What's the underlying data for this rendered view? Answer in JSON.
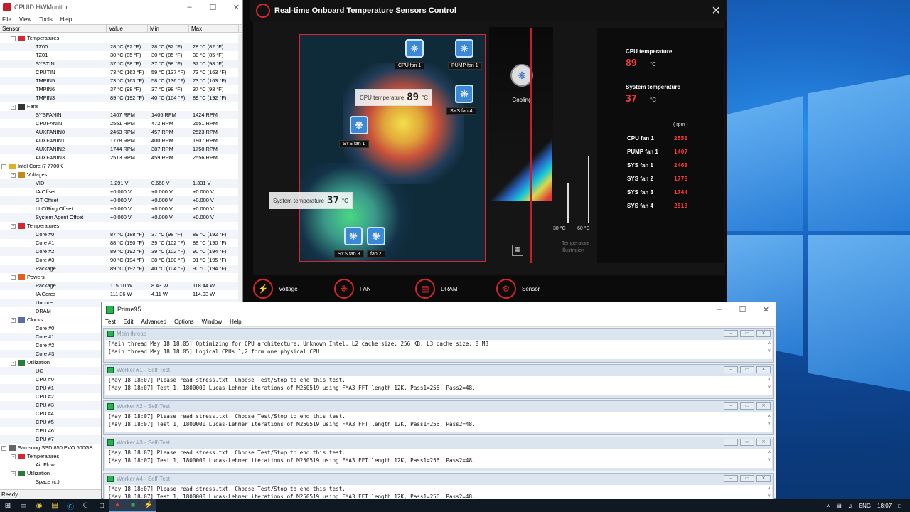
{
  "hwmonitor": {
    "title": "CPUID HWMonitor",
    "menu": [
      "File",
      "View",
      "Tools",
      "Help"
    ],
    "columns": [
      "Sensor",
      "Value",
      "Min",
      "Max"
    ],
    "status": "Ready",
    "rows": [
      {
        "indent": 2,
        "label": "Temperatures",
        "icon": "thermometer-icon",
        "toggle": "-"
      },
      {
        "indent": 3,
        "label": "TZ00",
        "v": "28 °C  (82 °F)",
        "min": "28 °C  (82 °F)",
        "max": "28 °C  (82 °F)"
      },
      {
        "indent": 3,
        "label": "TZ01",
        "v": "30 °C  (85 °F)",
        "min": "30 °C  (85 °F)",
        "max": "30 °C  (85 °F)"
      },
      {
        "indent": 3,
        "label": "SYSTIN",
        "v": "37 °C  (98 °F)",
        "min": "37 °C  (98 °F)",
        "max": "37 °C  (98 °F)"
      },
      {
        "indent": 3,
        "label": "CPUTIN",
        "v": "73 °C  (163 °F)",
        "min": "59 °C  (137 °F)",
        "max": "73 °C  (163 °F)"
      },
      {
        "indent": 3,
        "label": "TMPIN5",
        "v": "73 °C  (163 °F)",
        "min": "58 °C  (136 °F)",
        "max": "73 °C  (163 °F)"
      },
      {
        "indent": 3,
        "label": "TMPIN6",
        "v": "37 °C  (98 °F)",
        "min": "37 °C  (98 °F)",
        "max": "37 °C  (98 °F)"
      },
      {
        "indent": 3,
        "label": "TMPIN3",
        "v": "89 °C  (192 °F)",
        "min": "40 °C  (104 °F)",
        "max": "89 °C  (192 °F)"
      },
      {
        "indent": 2,
        "label": "Fans",
        "icon": "fan-icon",
        "toggle": "-"
      },
      {
        "indent": 3,
        "label": "SYSFANIN",
        "v": "1407 RPM",
        "min": "1406 RPM",
        "max": "1424 RPM"
      },
      {
        "indent": 3,
        "label": "CPUFANIN",
        "v": "2551 RPM",
        "min": "472 RPM",
        "max": "2551 RPM"
      },
      {
        "indent": 3,
        "label": "AUXFANIN0",
        "v": "2463 RPM",
        "min": "457 RPM",
        "max": "2523 RPM"
      },
      {
        "indent": 3,
        "label": "AUXFANIN1",
        "v": "1778 RPM",
        "min": "400 RPM",
        "max": "1807 RPM"
      },
      {
        "indent": 3,
        "label": "AUXFANIN2",
        "v": "1744 RPM",
        "min": "387 RPM",
        "max": "1750 RPM"
      },
      {
        "indent": 3,
        "label": "AUXFANIN3",
        "v": "2513 RPM",
        "min": "459 RPM",
        "max": "2556 RPM"
      },
      {
        "indent": 1,
        "label": "Intel Core i7 7700K",
        "icon": "chip-icon",
        "toggle": "-"
      },
      {
        "indent": 2,
        "label": "Voltages",
        "icon": "voltage-icon",
        "toggle": "-"
      },
      {
        "indent": 3,
        "label": "VID",
        "v": "1.291 V",
        "min": "0.668 V",
        "max": "1.331 V"
      },
      {
        "indent": 3,
        "label": "IA Offset",
        "v": "+0.000 V",
        "min": "+0.000 V",
        "max": "+0.000 V"
      },
      {
        "indent": 3,
        "label": "GT Offset",
        "v": "+0.000 V",
        "min": "+0.000 V",
        "max": "+0.000 V"
      },
      {
        "indent": 3,
        "label": "LLC/Ring Offset",
        "v": "+0.000 V",
        "min": "+0.000 V",
        "max": "+0.000 V"
      },
      {
        "indent": 3,
        "label": "System Agent Offset",
        "v": "+0.000 V",
        "min": "+0.000 V",
        "max": "+0.000 V"
      },
      {
        "indent": 2,
        "label": "Temperatures",
        "icon": "thermometer-icon",
        "toggle": "-"
      },
      {
        "indent": 3,
        "label": "Core #0",
        "v": "87 °C  (188 °F)",
        "min": "37 °C  (98 °F)",
        "max": "89 °C  (192 °F)"
      },
      {
        "indent": 3,
        "label": "Core #1",
        "v": "88 °C  (190 °F)",
        "min": "39 °C  (102 °F)",
        "max": "88 °C  (190 °F)"
      },
      {
        "indent": 3,
        "label": "Core #2",
        "v": "89 °C  (192 °F)",
        "min": "39 °C  (102 °F)",
        "max": "90 °C  (194 °F)"
      },
      {
        "indent": 3,
        "label": "Core #3",
        "v": "90 °C  (194 °F)",
        "min": "38 °C  (100 °F)",
        "max": "91 °C  (195 °F)"
      },
      {
        "indent": 3,
        "label": "Package",
        "v": "89 °C  (192 °F)",
        "min": "40 °C  (104 °F)",
        "max": "90 °C  (194 °F)"
      },
      {
        "indent": 2,
        "label": "Powers",
        "icon": "power-icon",
        "toggle": "-"
      },
      {
        "indent": 3,
        "label": "Package",
        "v": "115.10 W",
        "min": "8.43 W",
        "max": "118.44 W"
      },
      {
        "indent": 3,
        "label": "IA Cores",
        "v": "111.36 W",
        "min": "4.11 W",
        "max": "114.93 W"
      },
      {
        "indent": 3,
        "label": "Uncore",
        "v": "",
        "min": "",
        "max": ""
      },
      {
        "indent": 3,
        "label": "DRAM",
        "v": "",
        "min": "",
        "max": ""
      },
      {
        "indent": 2,
        "label": "Clocks",
        "icon": "clock-icon",
        "toggle": "-"
      },
      {
        "indent": 3,
        "label": "Core #0",
        "v": "",
        "min": "",
        "max": ""
      },
      {
        "indent": 3,
        "label": "Core #1",
        "v": "",
        "min": "",
        "max": ""
      },
      {
        "indent": 3,
        "label": "Core #2",
        "v": "",
        "min": "",
        "max": ""
      },
      {
        "indent": 3,
        "label": "Core #3",
        "v": "",
        "min": "",
        "max": ""
      },
      {
        "indent": 2,
        "label": "Utilization",
        "icon": "utilization-icon",
        "toggle": "-"
      },
      {
        "indent": 3,
        "label": "UC",
        "v": "",
        "min": "",
        "max": ""
      },
      {
        "indent": 3,
        "label": "CPU #0",
        "v": "",
        "min": "",
        "max": ""
      },
      {
        "indent": 3,
        "label": "CPU #1",
        "v": "",
        "min": "",
        "max": ""
      },
      {
        "indent": 3,
        "label": "CPU #2",
        "v": "",
        "min": "",
        "max": ""
      },
      {
        "indent": 3,
        "label": "CPU #3",
        "v": "",
        "min": "",
        "max": ""
      },
      {
        "indent": 3,
        "label": "CPU #4",
        "v": "",
        "min": "",
        "max": ""
      },
      {
        "indent": 3,
        "label": "CPU #5",
        "v": "",
        "min": "",
        "max": ""
      },
      {
        "indent": 3,
        "label": "CPU #6",
        "v": "",
        "min": "",
        "max": ""
      },
      {
        "indent": 3,
        "label": "CPU #7",
        "v": "",
        "min": "",
        "max": ""
      },
      {
        "indent": 1,
        "label": "Samsung SSD 850 EVO 500GB",
        "icon": "drive-icon",
        "toggle": "-"
      },
      {
        "indent": 2,
        "label": "Temperatures",
        "icon": "thermometer-icon",
        "toggle": "-"
      },
      {
        "indent": 3,
        "label": "Air Flow",
        "v": "",
        "min": "",
        "max": ""
      },
      {
        "indent": 2,
        "label": "Utilization",
        "icon": "utilization-icon",
        "toggle": "-"
      },
      {
        "indent": 3,
        "label": "Space (c:)",
        "v": "",
        "min": "",
        "max": ""
      }
    ]
  },
  "msi": {
    "title": "Real-time Onboard Temperature Sensors Control",
    "cpu_temp_label": "CPU temperature",
    "cpu_temp_value": "89",
    "sys_temp_label": "System temperature",
    "sys_temp_value": "37",
    "unit_c": "°C",
    "rpm_label": "( rpm )",
    "cooling_label": "Cooling",
    "temp_illus_label": "Temperature\nIllustration",
    "scale_low": "30 °C",
    "scale_high": "60 °C",
    "fans": [
      {
        "name": "CPU fan 1",
        "rpm": "2551"
      },
      {
        "name": "PUMP fan 1",
        "rpm": "1407"
      },
      {
        "name": "SYS fan 1",
        "rpm": "2463"
      },
      {
        "name": "SYS fan 2",
        "rpm": "1778"
      },
      {
        "name": "SYS fan 3",
        "rpm": "1744"
      },
      {
        "name": "SYS fan 4",
        "rpm": "2513"
      }
    ],
    "board_labels": {
      "cpu_fan1": "CPU fan 1",
      "pump_fan1": "PUMP fan 1",
      "sys_fan4": "SYS fan 4",
      "sys_fan1": "SYS fan 1",
      "sys_fan3": "SYS fan 3",
      "sys_fan2": "fan 2",
      "cpu_temp_box": "CPU temperature",
      "cpu_temp_box_val": "89",
      "sys_temp_box": "System temperature",
      "sys_temp_box_val": "37"
    },
    "nav": [
      "Voltage",
      "FAN",
      "DRAM",
      "Sensor"
    ],
    "accent": "#d6262f"
  },
  "prime95": {
    "title": "Prime95",
    "menu": [
      "Test",
      "Edit",
      "Advanced",
      "Options",
      "Window",
      "Help"
    ],
    "windows": [
      {
        "title": "Main thread",
        "lines": [
          "[Main thread May 18 18:05] Optimizing for CPU architecture: Unknown Intel, L2 cache size: 256 KB, L3 cache size: 8 MB",
          "[Main thread May 18 18:05] Logical CPUs 1,2 form one physical CPU."
        ]
      },
      {
        "title": "Worker #1 - Self-Test",
        "lines": [
          "[May 18 18:07] Please read stress.txt.  Choose Test/Stop to end this test.",
          "[May 18 18:07] Test 1, 1800000 Lucas-Lehmer iterations of M250519 using FMA3 FFT length 12K, Pass1=256, Pass2=48."
        ]
      },
      {
        "title": "Worker #2 - Self-Test",
        "lines": [
          "[May 18 18:07] Please read stress.txt.  Choose Test/Stop to end this test.",
          "[May 18 18:07] Test 1, 1800000 Lucas-Lehmer iterations of M250519 using FMA3 FFT length 12K, Pass1=256, Pass2=48."
        ]
      },
      {
        "title": "Worker #3 - Self-Test",
        "lines": [
          "[May 18 18:07] Please read stress.txt.  Choose Test/Stop to end this test.",
          "[May 18 18:07] Test 1, 1800000 Lucas-Lehmer iterations of M250519 using FMA3 FFT length 12K, Pass1=256, Pass2=48."
        ]
      },
      {
        "title": "Worker #4 - Self-Test",
        "lines": [
          "[May 18 18:07] Please read stress.txt.  Choose Test/Stop to end this test.",
          "[May 18 18:07] Test 1, 1800000 Lucas-Lehmer iterations of M250519 using FMA3 FFT length 12K, Pass1=256, Pass2=48."
        ]
      }
    ]
  },
  "taskbar": {
    "lang": "ENG",
    "time": "18:07"
  }
}
